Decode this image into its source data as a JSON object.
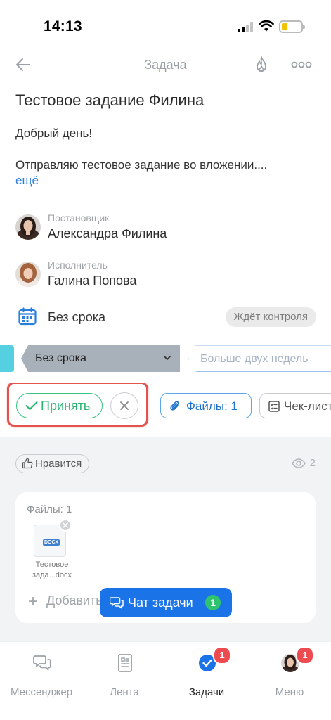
{
  "status_bar": {
    "time": "14:13"
  },
  "nav": {
    "title": "Задача"
  },
  "task": {
    "title": "Тестовое задание Филина",
    "greeting": "Добрый день!",
    "body": "Отправляю тестовое задание во вложении....",
    "more_link": "ещё"
  },
  "creator": {
    "role": "Постановщик",
    "name": "Александра Филина"
  },
  "assignee": {
    "role": "Исполнитель",
    "name": "Галина Попова"
  },
  "deadline": {
    "text": "Без срока",
    "status": "Ждёт контроля"
  },
  "stages": {
    "current": "Без срока",
    "next": "Больше двух недель"
  },
  "actions": {
    "accept": "Принять",
    "files": "Файлы: 1",
    "checklist": "Чек-лист"
  },
  "social": {
    "like": "Нравится",
    "views": "2"
  },
  "files_card": {
    "header": "Файлы: 1",
    "file_type_tag": "DOCX",
    "file_name_line1": "Тестовое",
    "file_name_line2": "зада...docx",
    "add_label": "Добавить"
  },
  "chat": {
    "label": "Чат задачи",
    "count": "1"
  },
  "tabs": [
    {
      "label": "Мессенджер",
      "badge": ""
    },
    {
      "label": "Лента",
      "badge": ""
    },
    {
      "label": "Задачи",
      "badge": "1"
    },
    {
      "label": "Меню",
      "badge": "1"
    }
  ],
  "colors": {
    "accent_blue": "#1a74e8",
    "accept_green": "#2bb573",
    "badge_red": "#ee4b50",
    "highlight_red": "#e3524c",
    "stage_cyan": "#55d0e0"
  }
}
